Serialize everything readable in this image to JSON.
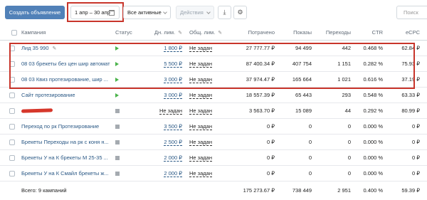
{
  "toolbar": {
    "create_label": "Создать объявление",
    "date_range": "1 апр – 30 апр",
    "status_filter": "Все активные",
    "actions_label": "Действия",
    "search_placeholder": "Поиск",
    "icons": [
      "download-icon",
      "gear-icon",
      "calendar-icon"
    ]
  },
  "table": {
    "headers": {
      "campaign": "Кампания",
      "status": "Статус",
      "day_limit": "Дн. лим.",
      "total_limit": "Общ. лим.",
      "spent": "Потрачено",
      "shows": "Показы",
      "clicks": "Переходы",
      "ctr": "CTR",
      "ecpc": "eCPC"
    },
    "rows": [
      {
        "name": "Лид 35 990",
        "status": "active",
        "day_limit": "1 800 ₽",
        "total_limit": "Не задан",
        "spent": "27 777.77 ₽",
        "shows": "94 499",
        "clicks": "442",
        "ctr": "0.468 %",
        "ecpc": "62.84 ₽"
      },
      {
        "name": "08 03 брекеты без цен шир автомат",
        "status": "active",
        "day_limit": "5 500 ₽",
        "total_limit": "Не задан",
        "spent": "87 400.34 ₽",
        "shows": "407 754",
        "clicks": "1 151",
        "ctr": "0.282 %",
        "ecpc": "75.93 ₽"
      },
      {
        "name": "08 03 Квиз протезирование, шир ...",
        "status": "active",
        "day_limit": "3 000 ₽",
        "total_limit": "Не задан",
        "spent": "37 974.47 ₽",
        "shows": "165 664",
        "clicks": "1 021",
        "ctr": "0.616 %",
        "ecpc": "37.19 ₽"
      },
      {
        "name": "Сайт протезирование",
        "status": "active",
        "day_limit": "3 000 ₽",
        "total_limit": "Не задан",
        "spent": "18 557.39 ₽",
        "shows": "65 443",
        "clicks": "293",
        "ctr": "0.548 %",
        "ecpc": "63.33 ₽"
      },
      {
        "name": "",
        "status": "stopped",
        "day_limit": "Не задан",
        "total_limit": "Не задан",
        "spent": "3 563.70 ₽",
        "shows": "15 089",
        "clicks": "44",
        "ctr": "0.292 %",
        "ecpc": "80.99 ₽"
      },
      {
        "name": "Переход по рк Протезирование",
        "status": "stopped",
        "day_limit": "3 500 ₽",
        "total_limit": "Не задан",
        "spent": "0 ₽",
        "shows": "0",
        "clicks": "0",
        "ctr": "0.000 %",
        "ecpc": "0 ₽"
      },
      {
        "name": "Брекеты Переходы на рк с коня н...",
        "status": "stopped",
        "day_limit": "2 500 ₽",
        "total_limit": "Не задан",
        "spent": "0 ₽",
        "shows": "0",
        "clicks": "0",
        "ctr": "0.000 %",
        "ecpc": "0 ₽"
      },
      {
        "name": "Брекеты У на К брекеты М 25-35 ...",
        "status": "stopped",
        "day_limit": "2 000 ₽",
        "total_limit": "Не задан",
        "spent": "0 ₽",
        "shows": "0",
        "clicks": "0",
        "ctr": "0.000 %",
        "ecpc": "0 ₽"
      },
      {
        "name": "Брекеты У на К Смайл брекеты ж...",
        "status": "stopped",
        "day_limit": "2 000 ₽",
        "total_limit": "Не задан",
        "spent": "0 ₽",
        "shows": "0",
        "clicks": "0",
        "ctr": "0.000 %",
        "ecpc": "0 ₽"
      }
    ],
    "totals": {
      "label": "Всего: 9 кампаний",
      "spent": "175 273.67 ₽",
      "shows": "738 449",
      "clicks": "2 951",
      "ctr": "0.400 %",
      "ecpc": "59.39 ₽"
    }
  },
  "colors": {
    "accent": "#5181b8",
    "link": "#2a5885",
    "highlight": "#c8352b",
    "active": "#4bb34b",
    "stopped": "#a5aab0"
  }
}
